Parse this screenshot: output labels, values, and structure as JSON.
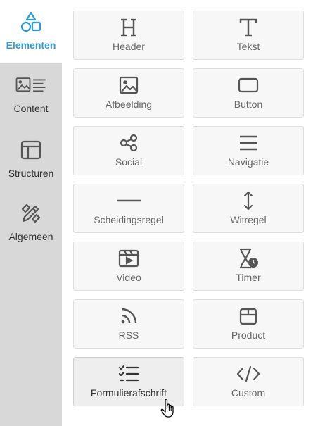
{
  "sidebar": {
    "items": [
      {
        "label": "Elementen",
        "icon": "shapes-icon",
        "active": true
      },
      {
        "label": "Content",
        "icon": "image-text-icon",
        "active": false
      },
      {
        "label": "Structuren",
        "icon": "layout-icon",
        "active": false
      },
      {
        "label": "Algemeen",
        "icon": "pencil-ruler-icon",
        "active": false
      }
    ],
    "active_color": "#2f9bd6"
  },
  "elements": [
    {
      "label": "Header",
      "icon": "header-h-icon"
    },
    {
      "label": "Tekst",
      "icon": "text-t-icon"
    },
    {
      "label": "Afbeelding",
      "icon": "image-icon"
    },
    {
      "label": "Button",
      "icon": "button-icon"
    },
    {
      "label": "Social",
      "icon": "share-icon"
    },
    {
      "label": "Navigatie",
      "icon": "menu-icon"
    },
    {
      "label": "Scheidingsregel",
      "icon": "divider-icon"
    },
    {
      "label": "Witregel",
      "icon": "spacer-icon"
    },
    {
      "label": "Video",
      "icon": "video-icon"
    },
    {
      "label": "Timer",
      "icon": "timer-icon"
    },
    {
      "label": "RSS",
      "icon": "rss-icon"
    },
    {
      "label": "Product",
      "icon": "product-box-icon"
    },
    {
      "label": "Formulierafschrift",
      "icon": "form-list-icon"
    },
    {
      "label": "Custom",
      "icon": "code-icon"
    }
  ]
}
